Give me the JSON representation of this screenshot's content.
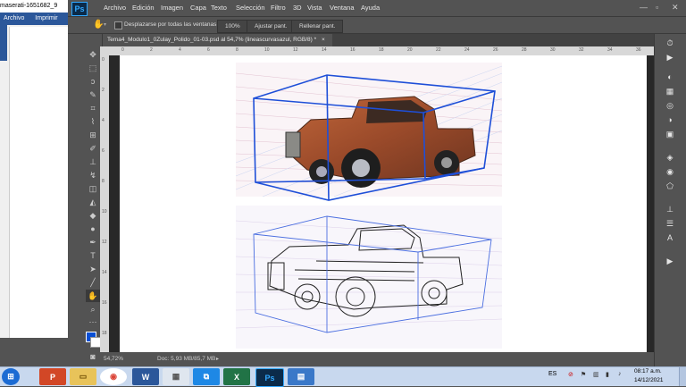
{
  "background_window": {
    "title": "maserati-1651682_9",
    "ribbon_tabs": [
      "Archivo",
      "Imprimir"
    ]
  },
  "photoshop": {
    "logo": "Ps",
    "menu": [
      "Archivo",
      "Edición",
      "Imagen",
      "Capa",
      "Texto",
      "Selección",
      "Filtro",
      "3D",
      "Vista",
      "Ventana",
      "Ayuda"
    ],
    "options": {
      "scroll_all": "Desplazarse por todas las ventanas",
      "zoom_value": "100%",
      "fit_screen": "Ajustar pant.",
      "fill_screen": "Rellenar pant."
    },
    "doc_tab": "Tema4_Modulo1_0Zulay_Polido_01-03.psd al 54,7% (lineascurvasazul, RGB/8) *",
    "status": {
      "zoom": "54,72%",
      "doc_info": "Doc: 5,93 MB/85,7 MB"
    },
    "ruler_h": [
      "0",
      "2",
      "4",
      "6",
      "8",
      "10",
      "12",
      "14",
      "16",
      "18",
      "20",
      "22",
      "24",
      "26",
      "28",
      "30",
      "32",
      "34",
      "36"
    ],
    "ruler_v": [
      "0",
      "2",
      "4",
      "6",
      "8",
      "10",
      "12",
      "14",
      "16",
      "18"
    ],
    "colors": {
      "foreground": "#0a4fd4",
      "background": "#ffffff"
    }
  },
  "taskbar": {
    "language": "ES",
    "time": "08:17 a.m.",
    "date": "14/12/2021"
  }
}
